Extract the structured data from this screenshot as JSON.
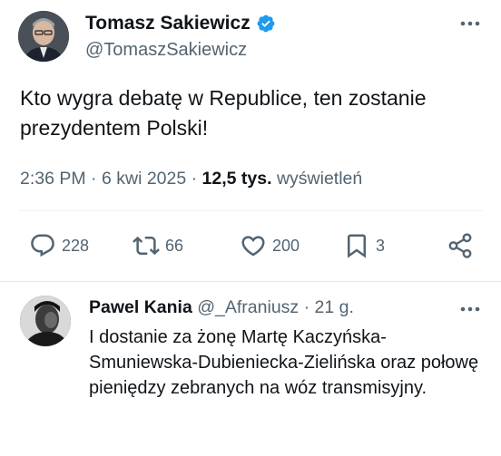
{
  "tweet": {
    "author": {
      "display_name": "Tomasz Sakiewicz",
      "handle": "@TomaszSakiewicz",
      "verified": true
    },
    "text": "Kto wygra debatę w Republice, ten zostanie prezydentem Polski!",
    "time": "2:36 PM",
    "sep1": "·",
    "date": "6 kwi 2025",
    "sep2": "·",
    "views_count": "12,5 tys.",
    "views_label": "wyświetleń",
    "stats": {
      "replies": "228",
      "reposts": "66",
      "likes": "200",
      "bookmarks": "3"
    }
  },
  "reply": {
    "author": {
      "display_name": "Pawel Kania",
      "handle": "@_Afraniusz"
    },
    "sep": "·",
    "time": "21 g.",
    "text": "I dostanie za żonę Martę Kaczyńska-Smuniewska-Dubieniecka-Zielińska oraz połowę pieniędzy zebranych na wóz transmisyjny."
  },
  "colors": {
    "text_primary": "#0f1419",
    "text_secondary": "#536471",
    "verified_blue": "#1d9bf0",
    "divider": "#eff3f4"
  },
  "icons": [
    "verified-badge-icon",
    "more-icon",
    "reply-icon",
    "repost-icon",
    "like-icon",
    "bookmark-icon",
    "share-icon"
  ]
}
